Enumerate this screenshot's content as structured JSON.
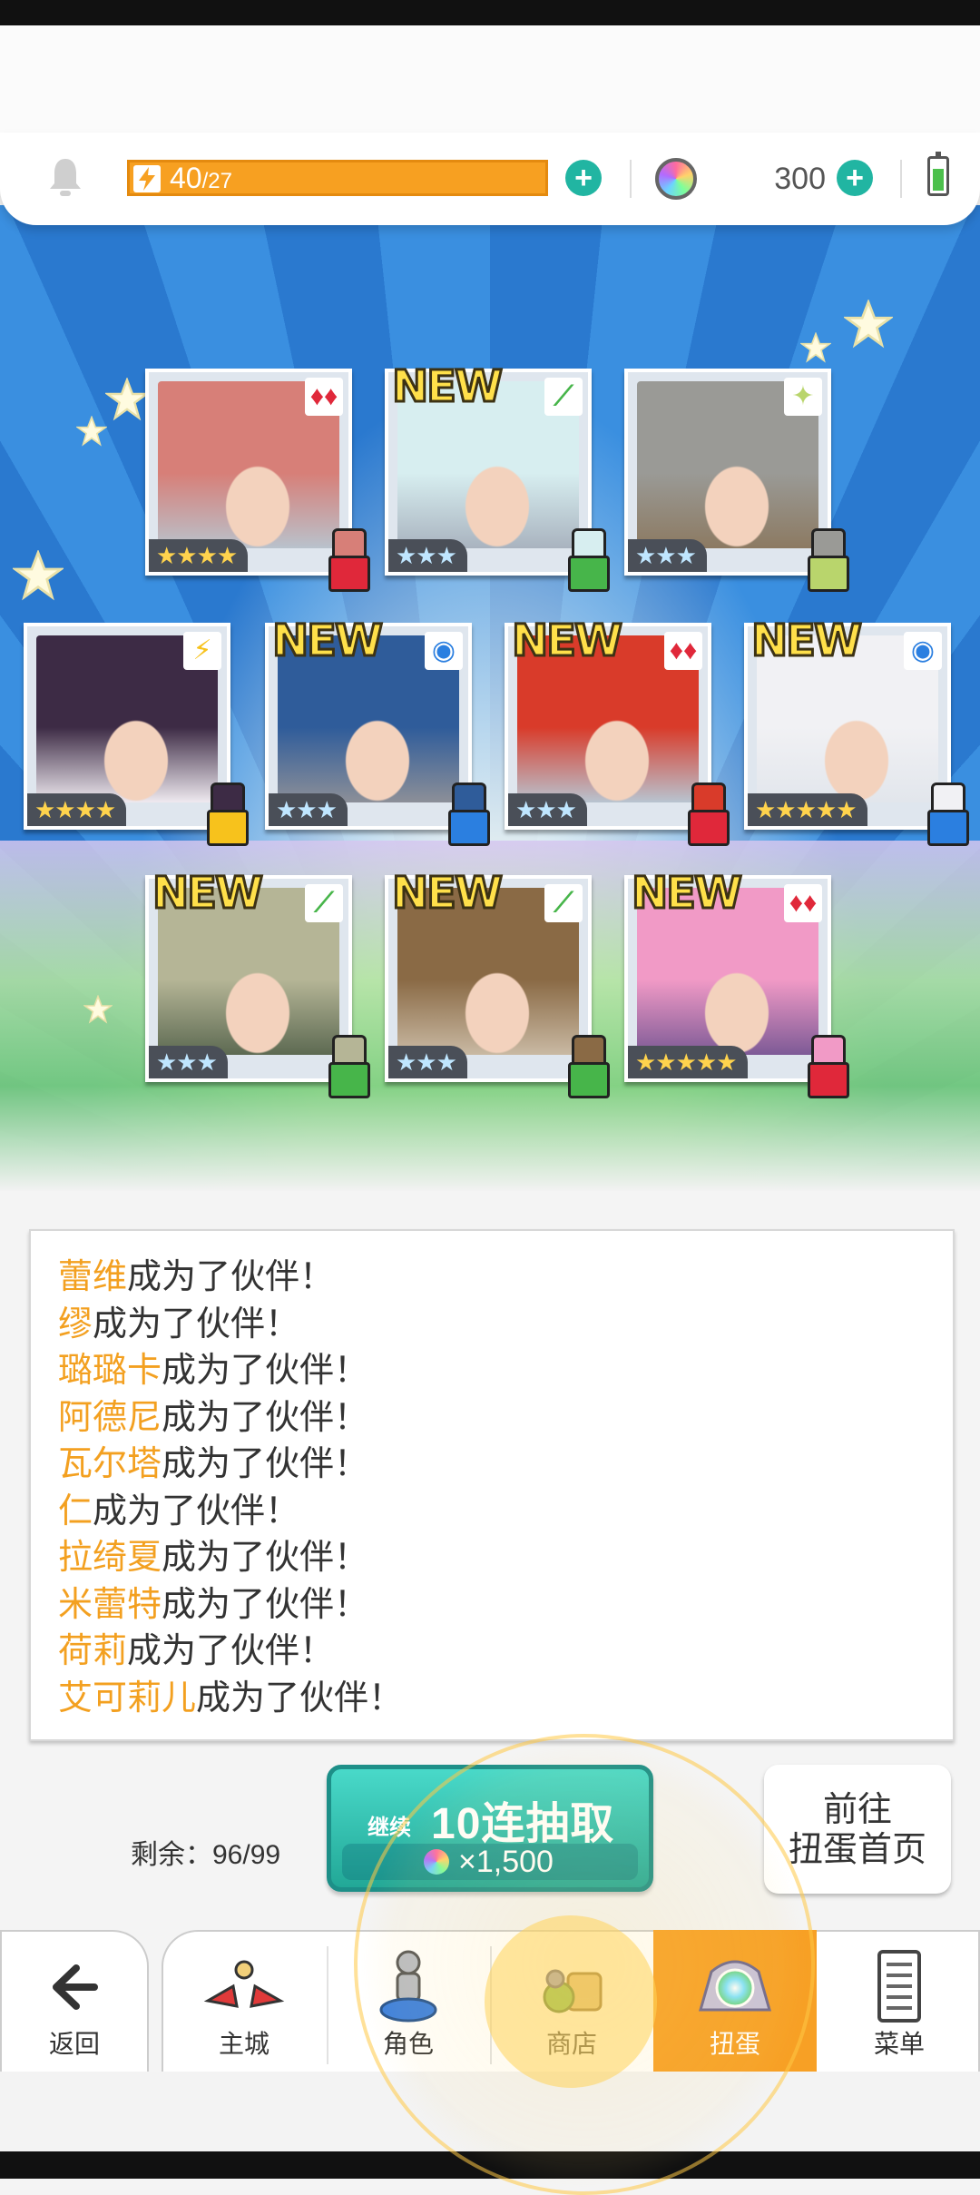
{
  "topbar": {
    "energy": {
      "current": "40",
      "max": "/27"
    },
    "gems": "300",
    "icons": [
      "bell-icon",
      "bolt-icon",
      "plus-icon",
      "gem-icon",
      "battery-icon"
    ]
  },
  "cards": [
    {
      "new": "",
      "stars": "★★★★",
      "element": "♦♦",
      "element_color": "#e0283a",
      "hair": "#d77f78",
      "bg": "#b9c2cc"
    },
    {
      "new": "NEW",
      "stars": "★★★",
      "element": "⟋",
      "element_color": "#47b54a",
      "hair": "#d7eef0",
      "bg": "#a9b3bf"
    },
    {
      "new": "",
      "stars": "★★★",
      "element": "✦",
      "element_color": "#b9d56c",
      "hair": "#9a9a96",
      "bg": "#8c7a62"
    },
    {
      "new": "",
      "stars": "★★★★",
      "element": "⚡",
      "element_color": "#f7c21c",
      "hair": "#3d2b45",
      "bg": "#efeaf0"
    },
    {
      "new": "NEW",
      "stars": "★★★",
      "element": "◉",
      "element_color": "#2b7fe0",
      "hair": "#2f5c9a",
      "bg": "#8c8f98"
    },
    {
      "new": "NEW",
      "stars": "★★★",
      "element": "♦♦",
      "element_color": "#e0283a",
      "hair": "#d93b2a",
      "bg": "#b8c4d0"
    },
    {
      "new": "NEW",
      "stars": "★★★★★",
      "element": "◉",
      "element_color": "#2b7fe0",
      "hair": "#f1f1f4",
      "bg": "#e2e6ec"
    },
    {
      "new": "NEW",
      "stars": "★★★",
      "element": "⟋",
      "element_color": "#47b54a",
      "hair": "#b5b596",
      "bg": "#5d6a52"
    },
    {
      "new": "NEW",
      "stars": "★★★",
      "element": "⟋",
      "element_color": "#47b54a",
      "hair": "#8a6a45",
      "bg": "#c9b9a3"
    },
    {
      "new": "NEW",
      "stars": "★★★★★",
      "element": "♦♦",
      "element_color": "#e0283a",
      "hair": "#f19ac6",
      "bg": "#7d5a96"
    }
  ],
  "log": [
    {
      "name": "蕾维",
      "suffix": "成为了伙伴！"
    },
    {
      "name": "缪",
      "suffix": "成为了伙伴！"
    },
    {
      "name": "璐璐卡",
      "suffix": "成为了伙伴！"
    },
    {
      "name": "阿德尼",
      "suffix": "成为了伙伴！"
    },
    {
      "name": "瓦尔塔",
      "suffix": "成为了伙伴！"
    },
    {
      "name": "仁",
      "suffix": "成为了伙伴！"
    },
    {
      "name": "拉绮夏",
      "suffix": "成为了伙伴！"
    },
    {
      "name": "米蕾特",
      "suffix": "成为了伙伴！"
    },
    {
      "name": "荷莉",
      "suffix": "成为了伙伴！"
    },
    {
      "name": "艾可莉儿",
      "suffix": "成为了伙伴！"
    }
  ],
  "gacha": {
    "remaining": "剩余：96/99",
    "continue": "继续",
    "button": "10连抽取",
    "cost": "×1,500",
    "goto_line1": "前往",
    "goto_line2": "扭蛋首页"
  },
  "nav": {
    "back": "返回",
    "items": [
      "主城",
      "角色",
      "商店",
      "扭蛋",
      "菜单"
    ]
  },
  "colors": {
    "accent": "#f7a025",
    "teal": "#22a897",
    "name": "#f3a020"
  }
}
